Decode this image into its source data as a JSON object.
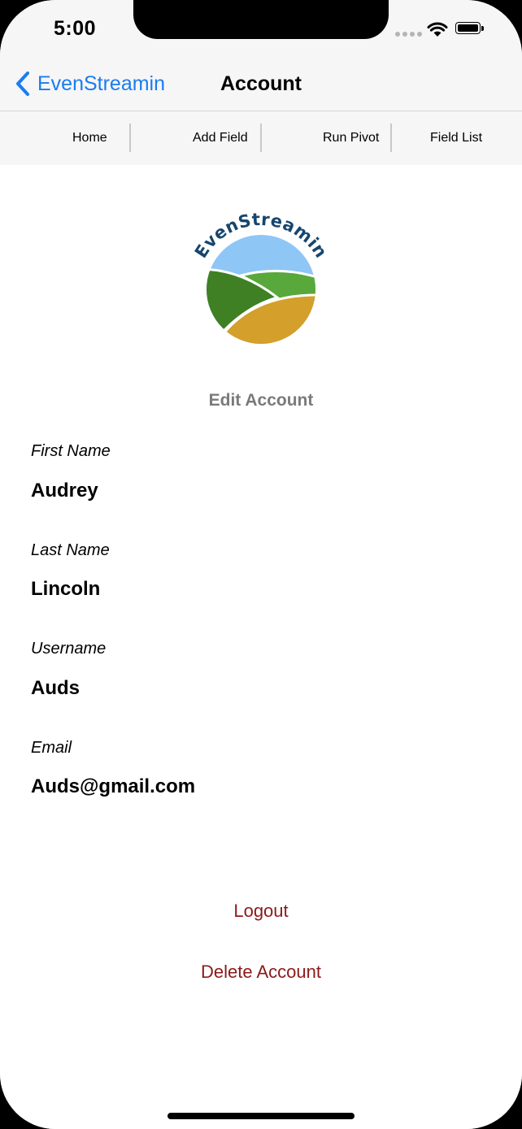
{
  "status_bar": {
    "time": "5:00"
  },
  "nav": {
    "back_label": "EvenStreamin",
    "title": "Account",
    "accent_color": "#1a7cf0"
  },
  "tabs": [
    {
      "label": "Home"
    },
    {
      "label": "Add Field"
    },
    {
      "label": "Run Pivot"
    },
    {
      "label": "Field List"
    }
  ],
  "logo": {
    "text": "EvenStreamin",
    "colors": {
      "text": "#17466e",
      "sky": "#8ec6f6",
      "dark_hill": "#3e8023",
      "light_hill": "#58a83b",
      "field": "#d49f2a"
    }
  },
  "section_title": "Edit Account",
  "fields": [
    {
      "label": "First Name",
      "value": "Audrey"
    },
    {
      "label": "Last Name",
      "value": "Lincoln"
    },
    {
      "label": "Username",
      "value": "Auds"
    },
    {
      "label": "Email",
      "value": "Auds@gmail.com"
    }
  ],
  "actions": {
    "logout_label": "Logout",
    "delete_label": "Delete Account",
    "color": "#8c1a1a"
  },
  "icons": [
    "chevron-left-icon",
    "wifi-icon",
    "battery-icon",
    "signal-icon"
  ]
}
